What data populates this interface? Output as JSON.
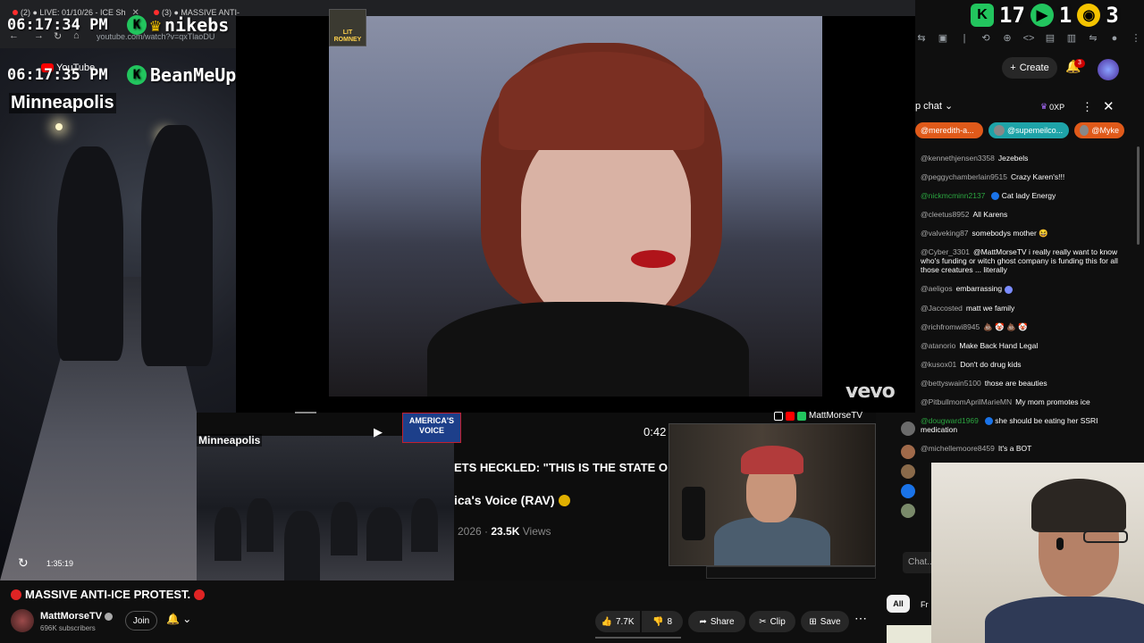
{
  "browser": {
    "tabs": [
      {
        "label": "(2) ● LIVE: 01/10/26 - ICE Sh"
      },
      {
        "label": "(3) ● MASSIVE ANTI-"
      }
    ],
    "url": "youtube.com/watch?v=qxTlaoDU"
  },
  "overlay": {
    "clock_top": "06:17:34 PM",
    "clock_second": "06:17:35 PM",
    "user_top": "nikebs",
    "user_second": "BeanMeUp",
    "yt_logo": "YouTube",
    "counters": [
      {
        "icon": "K",
        "value": "17",
        "color": "#22c55e"
      },
      {
        "icon": "▶",
        "value": "1",
        "color": "#22c55e"
      },
      {
        "icon": "◉",
        "value": "3",
        "color": "#f5c400"
      }
    ]
  },
  "main_video": {
    "city_label": "Minneapolis",
    "duration": "1:35:19"
  },
  "vevo": {
    "logo": "vevo",
    "avatar_text": "LIT ROMNEY"
  },
  "tweet": {
    "city_label": "Minneapolis",
    "badge": "AMERICA'S VOICE",
    "headline": "ETS HECKLED: \"THIS IS THE STATE O",
    "author": "ica's Voice (RAV)",
    "date": "2026",
    "views": "23.5K",
    "views_label": "Views",
    "time": "0:42"
  },
  "cam1": {
    "label": "MattMorseTV"
  },
  "chat": {
    "create_label": "Create",
    "bell_count": "3",
    "title": "p chat",
    "xp": "0XP",
    "pills": [
      {
        "label": "@meredith-a...",
        "color": "#e05a1a"
      },
      {
        "label": "@supemeilco...",
        "color": "#1ea3a8"
      },
      {
        "label": "@Myke",
        "color": "#e05a1a"
      }
    ],
    "messages": [
      {
        "author": "@kennethjensen3358",
        "text": "Jezebels",
        "green": false
      },
      {
        "author": "@peggychamberlain9515",
        "text": "Crazy Karen's!!!",
        "green": false
      },
      {
        "author": "@nickmcminn2137",
        "text": "Cat lady Energy",
        "green": true
      },
      {
        "author": "@cleetus8952",
        "text": "All Karens",
        "green": false
      },
      {
        "author": "@valveking87",
        "text": "somebodys mother 😆",
        "green": false
      },
      {
        "author": "@Cyber_3301",
        "text": "@MattMorseTV i really really want to know who's funding or witch ghost company is funding this for all those creatures ... literally",
        "green": false
      },
      {
        "author": "@aeligos",
        "text": "embarrassing",
        "green": false
      },
      {
        "author": "@Jaccosted",
        "text": "matt we family",
        "green": false
      },
      {
        "author": "@richfromwi8945",
        "text": "💩 🤡 💩 🤡",
        "green": false
      },
      {
        "author": "@atanorio",
        "text": "Make Back Hand Legal",
        "green": false
      },
      {
        "author": "@kusox01",
        "text": "Don't do drug kids",
        "green": false
      },
      {
        "author": "@bettyswain5100",
        "text": "those are beauties",
        "green": false
      },
      {
        "author": "@PitbullmomAprilMarieMN",
        "text": "My mom promotes ice",
        "green": false
      },
      {
        "author": "@dougward1969",
        "text": "she should be eating her SSRI medication",
        "green": true
      },
      {
        "author": "@michellemoore8459",
        "text": "It's a BOT",
        "green": false
      }
    ],
    "input_placeholder": "Chat..."
  },
  "info": {
    "title": "MASSIVE ANTI-ICE PROTEST.",
    "channel": "MattMorseTV",
    "subscribers": "696K subscribers",
    "join": "Join",
    "likes": "7.7K",
    "dislikes": "8",
    "share": "Share",
    "clip": "Clip",
    "save": "Save",
    "filter_all": "All",
    "filter_fr": "Fr"
  }
}
